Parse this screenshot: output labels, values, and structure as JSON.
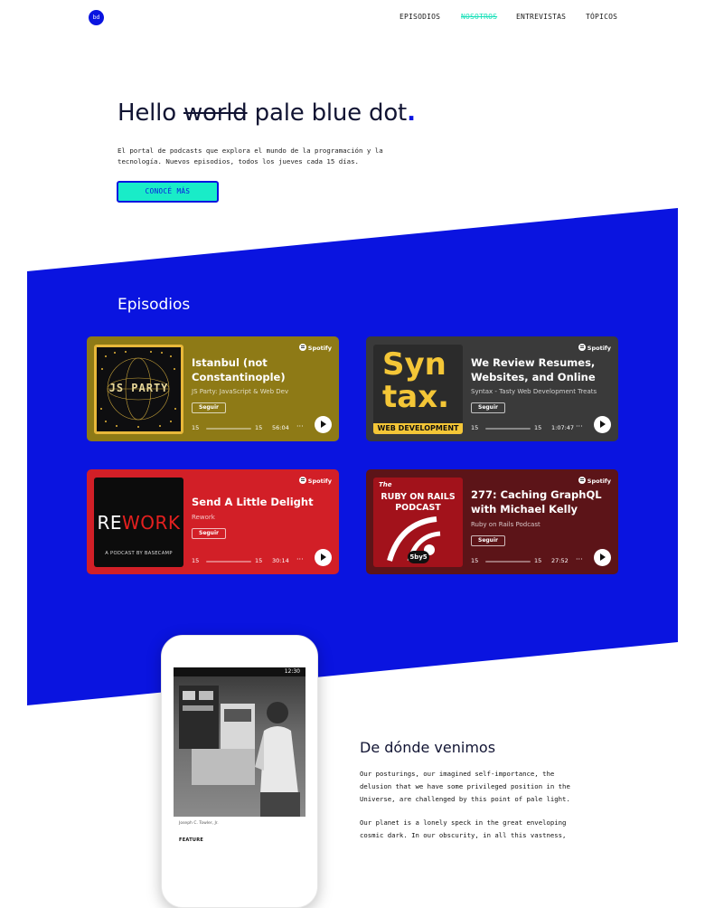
{
  "header": {
    "logo_text": "bd",
    "nav": [
      "EPISODIOS",
      "NOSOTROS",
      "ENTREVISTAS",
      "TÓPICOS"
    ],
    "active_nav": "NOSOTROS"
  },
  "hero": {
    "title_pre": "Hello",
    "title_struck": "world",
    "title_post": "pale blue dot",
    "title_dot": ".",
    "description": "El portal de podcasts que explora el mundo de la programación y la tecnología. Nuevos episodios, todos los jueves cada 15 días.",
    "cta": "CONOCÉ MÁS"
  },
  "episodes": {
    "title": "Episodios",
    "spotify_label": "Spotify",
    "follow_label": "Seguir",
    "skip_back": "15",
    "skip_fwd": "15",
    "more": "···",
    "items": [
      {
        "title": "Istanbul (not Constantinople)",
        "show": "JS Party: JavaScript & Web Dev",
        "duration": "56:04",
        "color": "#8e7a16",
        "art_text": "JS PARTY"
      },
      {
        "title": "We Review Resumes, Websites, and Online Pre...",
        "show": "Syntax - Tasty Web Development Treats",
        "duration": "1:07:47",
        "color": "#3a3a3a",
        "art_text": "Syn tax.",
        "art_sub": "WEB DEVELOPMENT"
      },
      {
        "title": "Send A Little Delight",
        "show": "Rework",
        "duration": "30:14",
        "color": "#d21f27",
        "art_text": "REWORK",
        "art_sub": "A PODCAST BY BASECAMP"
      },
      {
        "title": "277: Caching GraphQL with Michael Kelly",
        "show": "Ruby on Rails Podcast",
        "duration": "27:52",
        "color": "#5c1418",
        "art_pre": "The",
        "art_text": "RUBY ON RAILS PODCAST",
        "art_sub": "5by5"
      }
    ]
  },
  "phone": {
    "time": "12:30",
    "caption": "Joseph C. Towler, Jr.",
    "feature": "FEATURE"
  },
  "origin": {
    "title": "De dónde venimos",
    "p1": "Our posturings, our imagined self-importance, the delusion that we have some privileged position in the Universe, are challenged by this point of pale light.",
    "p2": "Our planet is a lonely speck in the great enveloping cosmic dark. In our obscurity, in all this vastness,"
  },
  "colors": {
    "accent_blue": "#0a14e0",
    "accent_teal": "#19ecc8"
  }
}
